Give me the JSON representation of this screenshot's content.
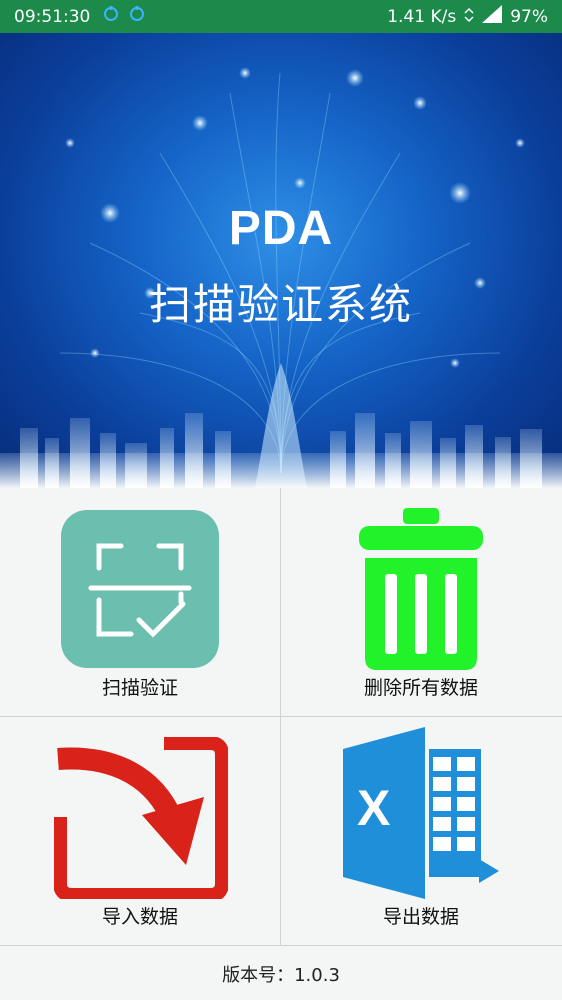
{
  "status_bar": {
    "time": "09:51:30",
    "network_speed": "1.41 K/s",
    "battery": "97%",
    "icons": [
      "notification-icon",
      "notification-icon",
      "wifi-icon",
      "signal-icon"
    ]
  },
  "banner": {
    "title_en": "PDA",
    "title_cn": "扫描验证系统"
  },
  "menu": {
    "scan": {
      "label": "扫描验证",
      "icon": "scan-verify-icon",
      "color": "#6bbfae"
    },
    "delete_all": {
      "label": "删除所有数据",
      "icon": "trash-icon",
      "color": "#22f22a"
    },
    "import": {
      "label": "导入数据",
      "icon": "import-icon",
      "color": "#d9231a"
    },
    "export": {
      "label": "导出数据",
      "icon": "excel-export-icon",
      "color": "#1e8fd8"
    }
  },
  "footer": {
    "version_text": "版本号：1.0.3"
  }
}
